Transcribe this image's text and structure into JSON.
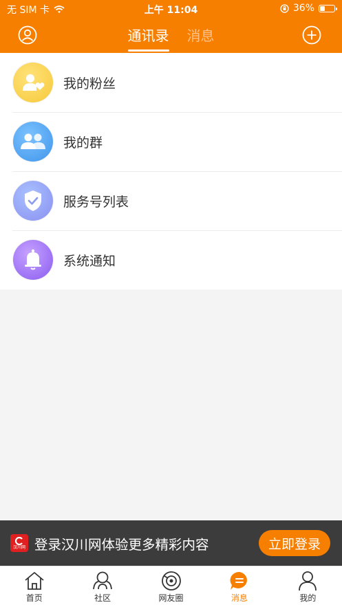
{
  "status_bar": {
    "carrier": "无 SIM 卡",
    "time": "上午 11:04",
    "battery": "36%",
    "battery_level": 0.36
  },
  "header": {
    "tabs": [
      {
        "label": "通讯录",
        "active": true
      },
      {
        "label": "消息",
        "active": false
      }
    ],
    "profile_icon": "person-circle-icon",
    "add_icon": "plus-circle-icon"
  },
  "contacts": {
    "items": [
      {
        "label": "我的粉丝",
        "icon": "fans-icon",
        "color": "#f9d24a"
      },
      {
        "label": "我的群",
        "icon": "group-icon",
        "color": "#4aa3ee"
      },
      {
        "label": "服务号列表",
        "icon": "shield-check-icon",
        "color": "#8f9cf0"
      },
      {
        "label": "系统通知",
        "icon": "bell-icon",
        "color": "#9a6ff0"
      }
    ]
  },
  "banner": {
    "text": "登录汉川网体验更多精彩内容",
    "button": "立即登录",
    "logo_text": "汉川网"
  },
  "tabbar": {
    "items": [
      {
        "label": "首页",
        "icon": "home-icon",
        "active": false
      },
      {
        "label": "社区",
        "icon": "community-icon",
        "active": false
      },
      {
        "label": "网友圈",
        "icon": "circle-icon",
        "active": false
      },
      {
        "label": "消息",
        "icon": "message-icon",
        "active": true
      },
      {
        "label": "我的",
        "icon": "profile-icon",
        "active": false
      }
    ]
  },
  "colors": {
    "accent": "#f77f00",
    "banner_bg": "#3c3c3c",
    "page_bg": "#f4f4f4"
  }
}
